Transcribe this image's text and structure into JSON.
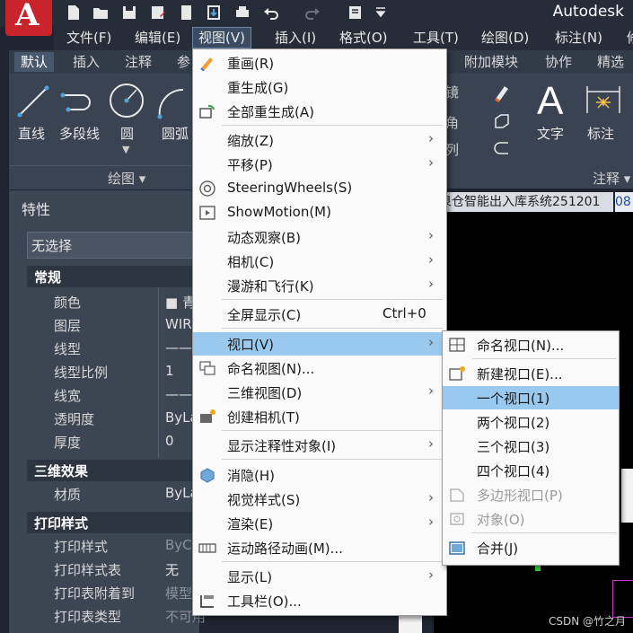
{
  "app": {
    "title": "Autodesk"
  },
  "menubar": {
    "items": [
      "文件(F)",
      "编辑(E)",
      "视图(V)",
      "插入(I)",
      "格式(O)",
      "工具(T)",
      "绘图(D)",
      "标注(N)",
      "修"
    ]
  },
  "ribbon": {
    "tabs": [
      "默认",
      "插入",
      "注释",
      "参",
      "附加模块",
      "协作",
      "精选应"
    ],
    "draw_tools": [
      "直线",
      "多段线",
      "圆",
      "圆弧"
    ],
    "draw_panel_title": "绘图 ▾",
    "right_tools": [
      "文字",
      "标注"
    ],
    "annotation_panel_title": "注释 ▾",
    "partial_labels": [
      "镜",
      "角",
      "列"
    ]
  },
  "properties": {
    "title": "特性",
    "selection": "无选择",
    "sections": {
      "general": "常规",
      "three_d": "三维效果",
      "print": "打印样式"
    },
    "general_rows": [
      {
        "name": "颜色",
        "value": "■ 青"
      },
      {
        "name": "图层",
        "value": "WIR"
      },
      {
        "name": "线型",
        "value": "——"
      },
      {
        "name": "线型比例",
        "value": "1"
      },
      {
        "name": "线宽",
        "value": "——"
      },
      {
        "name": "透明度",
        "value": "ByLa"
      },
      {
        "name": "厚度",
        "value": "0"
      }
    ],
    "three_d_rows": [
      {
        "name": "材质",
        "value": "ByLa"
      }
    ],
    "print_rows": [
      {
        "name": "打印样式",
        "value": "ByC"
      },
      {
        "name": "打印样式表",
        "value": "无"
      },
      {
        "name": "打印表附着到",
        "value": "模型"
      },
      {
        "name": "打印表类型",
        "value": "不可用"
      }
    ]
  },
  "document": {
    "tab_label": "泉仓智能出入库系统251201",
    "tab2_label": "08"
  },
  "view_menu": {
    "items": [
      {
        "label": "重画(R)",
        "icon": "redraw-icon"
      },
      {
        "label": "重生成(G)"
      },
      {
        "label": "全部重生成(A)",
        "icon": "regen-all-icon"
      },
      {
        "label": "缩放(Z)",
        "arrow": "›"
      },
      {
        "label": "平移(P)",
        "arrow": "›"
      },
      {
        "label": "SteeringWheels(S)",
        "icon": "steering-wheel-icon"
      },
      {
        "label": "ShowMotion(M)",
        "icon": "showmotion-icon"
      },
      {
        "label": "动态观察(B)",
        "arrow": "›"
      },
      {
        "label": "相机(C)",
        "arrow": "›"
      },
      {
        "label": "漫游和飞行(K)",
        "arrow": "›"
      },
      {
        "label": "全屏显示(C)",
        "shortcut": "Ctrl+0"
      },
      {
        "label": "视口(V)",
        "arrow": "›",
        "highlighted": true
      },
      {
        "label": "命名视图(N)...",
        "icon": "named-view-icon"
      },
      {
        "label": "三维视图(D)",
        "arrow": "›"
      },
      {
        "label": "创建相机(T)",
        "icon": "create-camera-icon"
      },
      {
        "label": "显示注释性对象(I)",
        "arrow": "›"
      },
      {
        "label": "消隐(H)",
        "icon": "hide-icon"
      },
      {
        "label": "视觉样式(S)",
        "arrow": "›"
      },
      {
        "label": "渲染(E)",
        "arrow": "›"
      },
      {
        "label": "运动路径动画(M)...",
        "icon": "motion-path-icon"
      },
      {
        "label": "显示(L)",
        "arrow": "›"
      },
      {
        "label": "工具栏(O)...",
        "icon": "toolbar-icon"
      }
    ]
  },
  "viewport_menu": {
    "items": [
      {
        "label": "命名视口(N)...",
        "icon": "named-viewport-icon"
      },
      {
        "label": "新建视口(E)...",
        "icon": "new-viewport-icon"
      },
      {
        "label": "一个视口(1)",
        "highlighted": true
      },
      {
        "label": "两个视口(2)"
      },
      {
        "label": "三个视口(3)"
      },
      {
        "label": "四个视口(4)"
      },
      {
        "label": "多边形视口(P)",
        "disabled": true,
        "icon": "polygon-viewport-icon"
      },
      {
        "label": "对象(O)",
        "disabled": true,
        "icon": "object-viewport-icon"
      },
      {
        "label": "合并(J)",
        "icon": "join-viewport-icon"
      }
    ]
  },
  "watermark": "CSDN @竹之月"
}
